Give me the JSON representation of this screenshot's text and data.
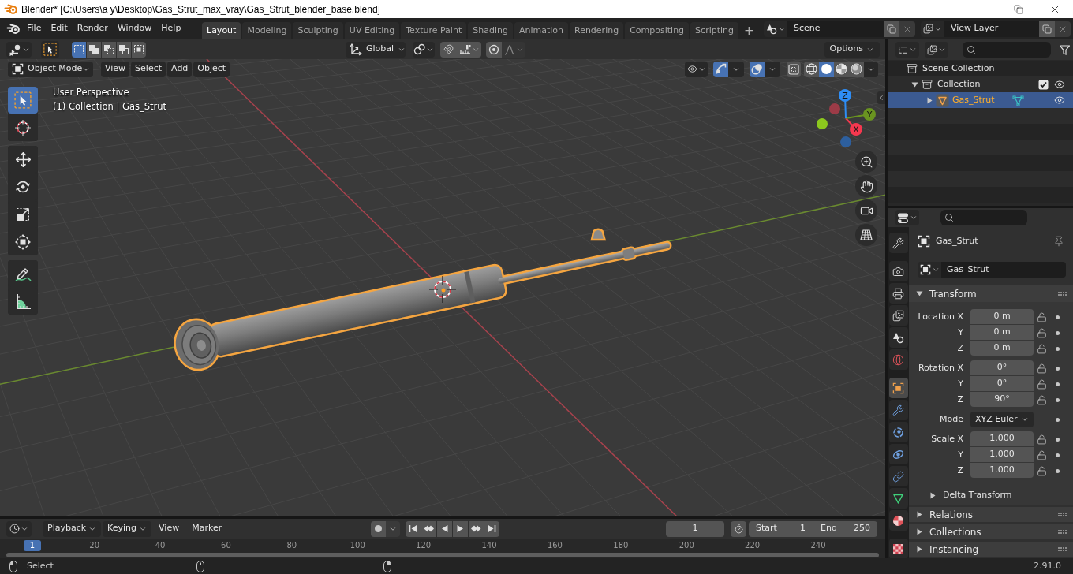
{
  "window": {
    "title": "Blender* [C:\\Users\\a y\\Desktop\\Gas_Strut_max_vray\\Gas_Strut_blender_base.blend]"
  },
  "menu": [
    "File",
    "Edit",
    "Render",
    "Window",
    "Help"
  ],
  "workspaces": [
    {
      "label": "Layout",
      "selected": true
    },
    {
      "label": "Modeling",
      "selected": false
    },
    {
      "label": "Sculpting",
      "selected": false
    },
    {
      "label": "UV Editing",
      "selected": false
    },
    {
      "label": "Texture Paint",
      "selected": false
    },
    {
      "label": "Shading",
      "selected": false
    },
    {
      "label": "Animation",
      "selected": false
    },
    {
      "label": "Rendering",
      "selected": false
    },
    {
      "label": "Compositing",
      "selected": false
    },
    {
      "label": "Scripting",
      "selected": false
    }
  ],
  "add_workspace": "+",
  "scene": "Scene",
  "view_layer": "View Layer",
  "tool_header": {
    "select_modes": [
      {
        "kind": "set",
        "selected": true
      },
      {
        "kind": "extend",
        "selected": false
      },
      {
        "kind": "subtract",
        "selected": false
      },
      {
        "kind": "invert",
        "selected": false
      },
      {
        "kind": "intersect",
        "selected": false
      }
    ],
    "orientation": "Global",
    "snap": false,
    "proportional_editing": false,
    "options": "Options"
  },
  "viewport_header": {
    "mode": "Object Mode",
    "menus": [
      "View",
      "Select",
      "Add",
      "Object"
    ],
    "gizmos": true,
    "overlays": true,
    "xray": false,
    "shading": [
      {
        "kind": "wireframe",
        "selected": false
      },
      {
        "kind": "solid",
        "selected": true
      },
      {
        "kind": "material",
        "selected": false
      },
      {
        "kind": "rendered",
        "selected": false
      }
    ]
  },
  "viewport": {
    "info": [
      "User Perspective",
      "(1) Collection | Gas_Strut"
    ],
    "tool_groups": [
      [
        {
          "kind": "select",
          "selected": true
        },
        {
          "kind": "cursor",
          "selected": false
        }
      ],
      [
        {
          "kind": "move",
          "selected": false
        },
        {
          "kind": "rotate",
          "selected": false
        },
        {
          "kind": "scale",
          "selected": false
        },
        {
          "kind": "transform",
          "selected": false
        }
      ],
      [
        {
          "kind": "annotate",
          "selected": false
        },
        {
          "kind": "measure",
          "selected": false
        }
      ]
    ],
    "gizmo_axes": [
      "X",
      "Y",
      "Z"
    ]
  },
  "outliner": {
    "tree": [
      {
        "label": "Scene Collection",
        "kind": "scene_collection",
        "selected": false,
        "children": [
          {
            "label": "Collection",
            "kind": "collection",
            "selected": false,
            "expanded": true,
            "checked": true,
            "visible": true,
            "children": [
              {
                "label": "Gas_Strut",
                "kind": "object",
                "selected": true,
                "expanded": false,
                "visible": true
              }
            ]
          }
        ]
      }
    ]
  },
  "properties": {
    "tab_groups": [
      [
        {
          "kind": "tool",
          "selected": false
        }
      ],
      [
        {
          "kind": "render",
          "selected": false
        },
        {
          "kind": "output",
          "selected": false
        },
        {
          "kind": "view_layer",
          "selected": false
        },
        {
          "kind": "scene",
          "selected": false
        },
        {
          "kind": "world",
          "selected": false
        }
      ],
      [
        {
          "kind": "object",
          "selected": true
        },
        {
          "kind": "modifiers",
          "selected": false
        },
        {
          "kind": "particles",
          "selected": false
        },
        {
          "kind": "physics",
          "selected": false
        },
        {
          "kind": "constraints",
          "selected": false
        },
        {
          "kind": "data",
          "selected": false
        },
        {
          "kind": "material",
          "selected": false
        }
      ],
      [
        {
          "kind": "texture",
          "selected": false
        }
      ]
    ],
    "context": "Gas_Strut",
    "name": "Gas_Strut",
    "panels": [
      {
        "title": "Transform",
        "expanded": true,
        "groups": [
          {
            "rows": [
              {
                "kind": "number",
                "label": "Location X",
                "value": "0 m",
                "locked": false
              },
              {
                "kind": "number",
                "label": "Y",
                "value": "0 m",
                "locked": false
              },
              {
                "kind": "number",
                "label": "Z",
                "value": "0 m",
                "locked": false
              }
            ]
          },
          {
            "rows": [
              {
                "kind": "number",
                "label": "Rotation X",
                "value": "0°",
                "locked": false
              },
              {
                "kind": "number",
                "label": "Y",
                "value": "0°",
                "locked": false
              },
              {
                "kind": "number",
                "label": "Z",
                "value": "90°",
                "locked": false
              }
            ]
          },
          {
            "rows": [
              {
                "kind": "dropdown",
                "label": "Mode",
                "value": "XYZ Euler"
              }
            ]
          },
          {
            "rows": [
              {
                "kind": "number",
                "label": "Scale X",
                "value": "1.000",
                "locked": false
              },
              {
                "kind": "number",
                "label": "Y",
                "value": "1.000",
                "locked": false
              },
              {
                "kind": "number",
                "label": "Z",
                "value": "1.000",
                "locked": false
              }
            ]
          }
        ],
        "subpanels": [
          {
            "title": "Delta Transform",
            "expanded": false
          }
        ]
      },
      {
        "title": "Relations",
        "expanded": false
      },
      {
        "title": "Collections",
        "expanded": false
      },
      {
        "title": "Instancing",
        "expanded": false
      }
    ]
  },
  "timeline": {
    "menus": [
      {
        "label": "Playback",
        "kind": "dropdown"
      },
      {
        "label": "Keying",
        "kind": "dropdown"
      },
      {
        "label": "View",
        "kind": "menu"
      },
      {
        "label": "Marker",
        "kind": "menu"
      }
    ],
    "auto_keying": false,
    "current_frame": "1",
    "start": {
      "label": "Start",
      "value": "1"
    },
    "end": {
      "label": "End",
      "value": "250"
    },
    "playhead": "1",
    "ticks": [
      "20",
      "40",
      "60",
      "80",
      "100",
      "120",
      "140",
      "160",
      "180",
      "200",
      "220",
      "240"
    ]
  },
  "status_bar": {
    "hints": [
      {
        "kind": "left",
        "label": "Select"
      },
      {
        "kind": "middle"
      },
      {
        "kind": "right"
      }
    ],
    "version": "2.91.0"
  }
}
